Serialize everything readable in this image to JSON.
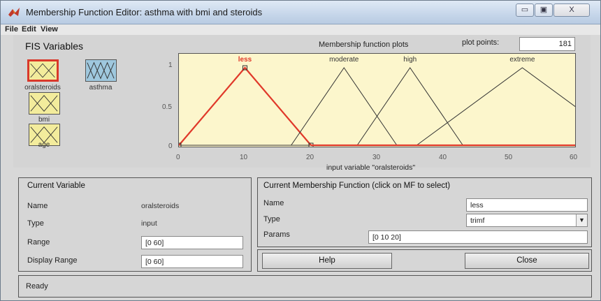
{
  "window": {
    "title": "Membership Function Editor: asthma with bmi and steroids",
    "controls": {
      "minimize": "▭",
      "maximize": "▣",
      "close": "X"
    }
  },
  "menu": {
    "items": [
      "File",
      "Edit",
      "View"
    ]
  },
  "fis_variables": {
    "title": "FIS Variables",
    "inputs": [
      {
        "name": "oralsteroids",
        "selected": true
      },
      {
        "name": "bmi",
        "selected": false
      },
      {
        "name": "age",
        "selected": false
      }
    ],
    "output": {
      "name": "asthma"
    }
  },
  "plot": {
    "title": "Membership function plots",
    "plot_points_label": "plot points:",
    "plot_points_value": "181",
    "x_axis_title": "input variable \"oralsteroids\"",
    "x_ticks": [
      "0",
      "10",
      "20",
      "30",
      "40",
      "50",
      "60"
    ],
    "y_ticks": [
      "0",
      "0.5",
      "1"
    ],
    "selected_color": "#e0392a",
    "line_color": "#333333"
  },
  "chart_data": {
    "type": "line",
    "xlim": [
      0,
      60
    ],
    "ylim": [
      0,
      1
    ],
    "xlabel": "input variable \"oralsteroids\"",
    "ylabel": "",
    "series": [
      {
        "name": "less",
        "x": [
          0,
          10,
          20
        ],
        "y": [
          0,
          1,
          0
        ],
        "selected": true
      },
      {
        "name": "moderate",
        "x": [
          17,
          25,
          33
        ],
        "y": [
          0,
          1,
          0
        ]
      },
      {
        "name": "high",
        "x": [
          27,
          35,
          43
        ],
        "y": [
          0,
          1,
          0
        ]
      },
      {
        "name": "extreme",
        "x": [
          36,
          52,
          68
        ],
        "y": [
          0,
          1,
          0
        ]
      }
    ]
  },
  "current_variable": {
    "title": "Current Variable",
    "name_label": "Name",
    "name_value": "oralsteroids",
    "type_label": "Type",
    "type_value": "input",
    "range_label": "Range",
    "range_value": "[0 60]",
    "display_range_label": "Display Range",
    "display_range_value": "[0 60]"
  },
  "current_mf": {
    "title": "Current Membership Function (click on MF to select)",
    "name_label": "Name",
    "name_value": "less",
    "type_label": "Type",
    "type_value": "trimf",
    "params_label": "Params",
    "params_value": "[0 10 20]"
  },
  "buttons": {
    "help": "Help",
    "close": "Close"
  },
  "status": {
    "text": "Ready"
  }
}
